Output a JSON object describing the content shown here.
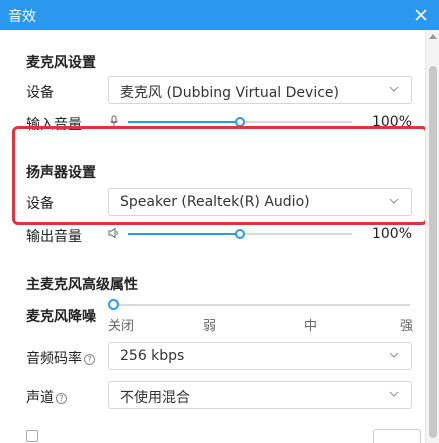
{
  "window": {
    "title": "音效"
  },
  "mic_settings": {
    "title": "麦克风设置",
    "device_label": "设备",
    "device_value": "麦克风 (Dubbing Virtual Device)",
    "volume_label": "输入音量",
    "volume_percent_text": "100%",
    "volume_level": 0.5
  },
  "speaker_settings": {
    "title": "扬声器设置",
    "device_label": "设备",
    "device_value": "Speaker (Realtek(R) Audio)",
    "volume_label": "输出音量",
    "volume_percent_text": "100%",
    "volume_level": 0.5,
    "highlight_color": "#d9363e"
  },
  "advanced": {
    "title": "主麦克风高级属性",
    "noise_label": "麦克风降噪",
    "noise_ticks": [
      "关闭",
      "弱",
      "中",
      "强"
    ],
    "noise_level": 0,
    "bitrate_label": "音频码率",
    "bitrate_help": "?",
    "bitrate_value": "256 kbps",
    "channel_label": "声道",
    "channel_help": "?",
    "channel_value": "不使用混合"
  },
  "theme": {
    "accent": "#2b98ee",
    "title_bar": "#2b98ee"
  },
  "icons": {
    "close": "close-icon",
    "dropdown": "chevron-down-icon",
    "mic_volume": "mic-icon",
    "speaker_volume": "speaker-icon"
  }
}
